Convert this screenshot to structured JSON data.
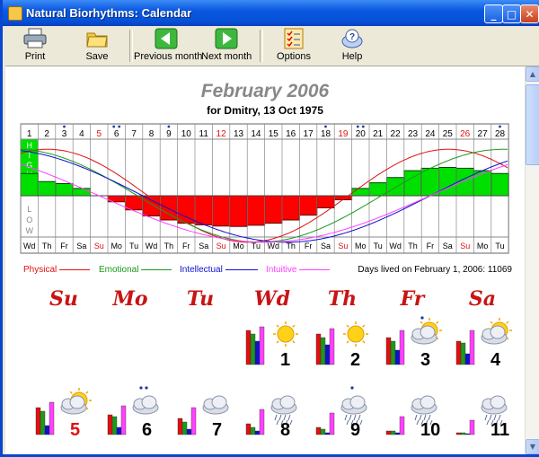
{
  "window": {
    "title": "Natural Biorhythms: Calendar",
    "controls": [
      "_",
      "□",
      "✕"
    ]
  },
  "toolbar": {
    "print": "Print",
    "save": "Save",
    "prev": "Previous month",
    "next": "Next month",
    "options": "Options",
    "help": "Help"
  },
  "header": {
    "month": "February 2006",
    "subtitle": "for Dmitry, 13 Oct 1975"
  },
  "chart": {
    "high_label": "H I G H",
    "low_label": "L O W",
    "dates": [
      "1",
      "2",
      "3",
      "4",
      "5",
      "6",
      "7",
      "8",
      "9",
      "10",
      "11",
      "12",
      "13",
      "14",
      "15",
      "16",
      "17",
      "18",
      "19",
      "20",
      "21",
      "22",
      "23",
      "24",
      "25",
      "26",
      "27",
      "28"
    ],
    "weekdays": [
      "Wd",
      "Th",
      "Fr",
      "Sa",
      "Su",
      "Mo",
      "Tu",
      "Wd",
      "Th",
      "Fr",
      "Sa",
      "Su",
      "Mo",
      "Tu",
      "Wd",
      "Th",
      "Fr",
      "Sa",
      "Su",
      "Mo",
      "Tu",
      "Wd",
      "Th",
      "Fr",
      "Sa",
      "Su",
      "Mo",
      "Tu"
    ],
    "sunday_dates": [
      "5",
      "12",
      "19",
      "26"
    ],
    "dot_counts": [
      0,
      0,
      1,
      0,
      0,
      2,
      0,
      0,
      1,
      0,
      0,
      0,
      0,
      0,
      0,
      0,
      0,
      1,
      0,
      2,
      0,
      0,
      0,
      0,
      0,
      0,
      0,
      1
    ],
    "bar_values": [
      0.55,
      0.35,
      0.3,
      0.18,
      0.0,
      -0.15,
      -0.35,
      -0.5,
      -0.6,
      -0.68,
      -0.72,
      -0.75,
      -0.76,
      -0.73,
      -0.68,
      -0.6,
      -0.48,
      -0.3,
      -0.1,
      0.18,
      0.32,
      0.45,
      0.62,
      0.68,
      0.7,
      0.68,
      0.62,
      0.55
    ],
    "colors": {
      "positive": "#00e000",
      "negative": "#ff0000",
      "physical": "#e01010",
      "emotional": "#1a9a1a",
      "intellectual": "#1010d0",
      "intuitive": "#ff40ff"
    }
  },
  "legend": {
    "physical": "Physical",
    "emotional": "Emotional",
    "intellectual": "Intellectual",
    "intuitive": "Intuitive",
    "days_lived": "Days lived on February 1, 2006: 11069"
  },
  "calendar": {
    "weekday_headers": [
      "Su",
      "Mo",
      "Tu",
      "Wd",
      "Th",
      "Fr",
      "Sa"
    ],
    "days": [
      {
        "day": "1",
        "weather": "sun",
        "dots": 0,
        "red": false
      },
      {
        "day": "2",
        "weather": "sun",
        "dots": 0,
        "red": false
      },
      {
        "day": "3",
        "weather": "partly",
        "dots": 1,
        "red": false
      },
      {
        "day": "4",
        "weather": "partly",
        "dots": 0,
        "red": false
      },
      {
        "day": "5",
        "weather": "partly",
        "dots": 0,
        "red": true
      },
      {
        "day": "6",
        "weather": "cloud",
        "dots": 2,
        "red": false
      },
      {
        "day": "7",
        "weather": "cloud",
        "dots": 0,
        "red": false
      },
      {
        "day": "8",
        "weather": "rain",
        "dots": 0,
        "red": false
      },
      {
        "day": "9",
        "weather": "rain",
        "dots": 1,
        "red": false
      },
      {
        "day": "10",
        "weather": "rain",
        "dots": 0,
        "red": false
      },
      {
        "day": "11",
        "weather": "rain",
        "dots": 0,
        "red": false
      }
    ]
  }
}
